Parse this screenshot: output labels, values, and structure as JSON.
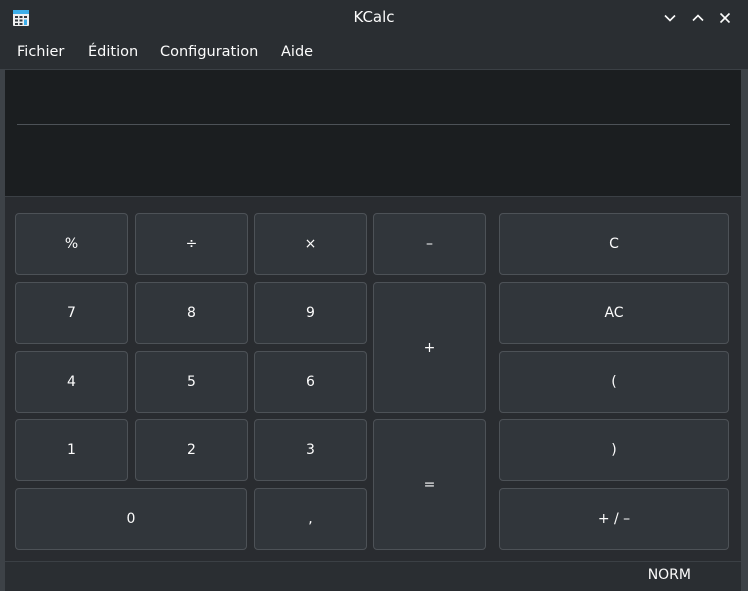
{
  "window": {
    "title": "KCalc"
  },
  "titlebar": {
    "app_icon": "calculator-icon",
    "buttons": [
      "chevron-down-icon",
      "chevron-up-icon",
      "close-icon"
    ]
  },
  "menubar": {
    "items": [
      "Fichier",
      "Édition",
      "Configuration",
      "Aide"
    ]
  },
  "display": {
    "previous": "",
    "result": ""
  },
  "keypad": {
    "percent": "%",
    "divide": "÷",
    "multiply": "×",
    "minus": "–",
    "clear": "C",
    "seven": "7",
    "eight": "8",
    "nine": "9",
    "plus": "+",
    "all_clear": "AC",
    "four": "4",
    "five": "5",
    "six": "6",
    "open_paren": "(",
    "one": "1",
    "two": "2",
    "three": "3",
    "equals": "=",
    "close_paren": ")",
    "zero": "0",
    "decimal": ",",
    "plus_minus": "+ / –"
  },
  "statusbar": {
    "mode": "NORM"
  }
}
